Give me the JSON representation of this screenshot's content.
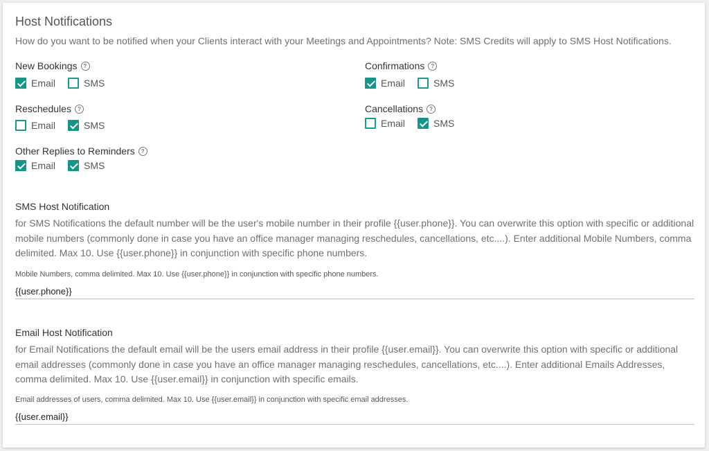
{
  "header": {
    "title": "Host Notifications",
    "subtitle": "How do you want to be notified when your Clients interact with your Meetings and Appointments? Note: SMS Credits will apply to SMS Host Notifications."
  },
  "groups": {
    "new_bookings": {
      "label": "New Bookings",
      "help": "?",
      "email": {
        "label": "Email",
        "checked": true
      },
      "sms": {
        "label": "SMS",
        "checked": false
      }
    },
    "confirmations": {
      "label": "Confirmations",
      "help": "?",
      "email": {
        "label": "Email",
        "checked": true
      },
      "sms": {
        "label": "SMS",
        "checked": false
      }
    },
    "reschedules": {
      "label": "Reschedules",
      "help": "?",
      "email": {
        "label": "Email",
        "checked": false
      },
      "sms": {
        "label": "SMS",
        "checked": true
      }
    },
    "cancellations": {
      "label": "Cancellations",
      "help": "?",
      "email": {
        "label": "Email",
        "checked": false
      },
      "sms": {
        "label": "SMS",
        "checked": true
      }
    },
    "other_replies": {
      "label": "Other Replies to Reminders",
      "help": "?",
      "email": {
        "label": "Email",
        "checked": true
      },
      "sms": {
        "label": "SMS",
        "checked": true
      }
    }
  },
  "sms_section": {
    "title": "SMS Host Notification",
    "description": "for SMS Notifications the default number will be the user's mobile number in their profile {{user.phone}}. You can overwrite this option with specific or additional mobile numbers (commonly done in case you have an office manager managing reschedules, cancellations, etc....). Enter additional Mobile Numbers, comma delimited. Max 10. Use {{user.phone}} in conjunction with specific phone numbers.",
    "field_label": "Mobile Numbers, comma delimited. Max 10. Use {{user.phone}} in conjunction with specific phone numbers.",
    "field_value": "{{user.phone}}"
  },
  "email_section": {
    "title": "Email Host Notification",
    "description": "for Email Notifications the default email will be the users email address in their profile {{user.email}}. You can overwrite this option with specific or additional email addresses (commonly done in case you have an office manager managing reschedules, cancellations, etc....). Enter additional Emails Addresses, comma delimited. Max 10. Use {{user.email}} in conjunction with specific emails.",
    "field_label": "Email addresses of users, comma delimited. Max 10. Use {{user.email}} in conjunction with specific email addresses.",
    "field_value": "{{user.email}}"
  },
  "colors": {
    "accent": "#159488"
  }
}
